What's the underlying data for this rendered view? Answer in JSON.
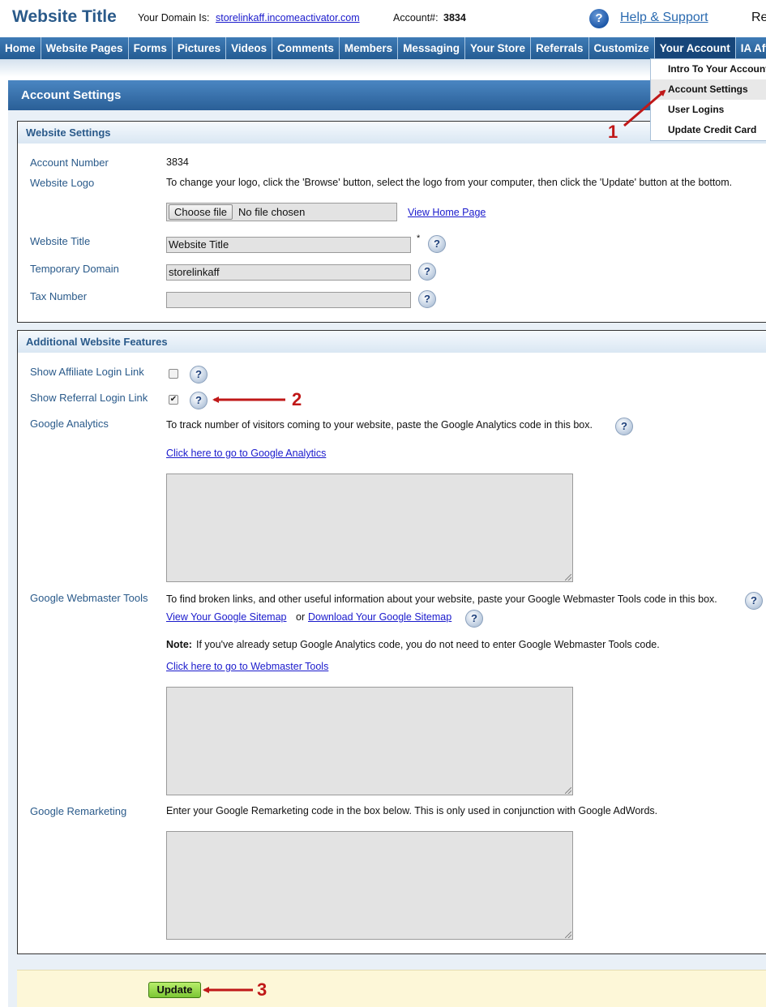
{
  "header": {
    "site_title": "Website Title",
    "domain_label": "Your Domain Is:",
    "domain_link": "storelinkaff.incomeactivator.com",
    "account_label": "Account#:",
    "account_number": "3834",
    "help_icon": "question-icon",
    "help_link": "Help & Support",
    "truncated_text": "Re"
  },
  "nav": {
    "items": [
      "Home",
      "Website Pages",
      "Forms",
      "Pictures",
      "Videos",
      "Comments",
      "Members",
      "Messaging",
      "Your Store",
      "Referrals",
      "Customize",
      "Your Account",
      "IA Affi"
    ],
    "active": "Your Account",
    "bar_color": "#2f6aa4"
  },
  "dropdown": {
    "items": [
      "Intro To Your Account",
      "Account Settings",
      "User Logins",
      "Update Credit Card"
    ],
    "selected": "Account Settings"
  },
  "panel": {
    "title": "Account Settings"
  },
  "website_settings": {
    "title": "Website Settings",
    "account_number_label": "Account Number",
    "account_number_value": "3834",
    "logo_label": "Website Logo",
    "logo_instructions": "To change your logo, click the 'Browse' button, select the logo from your computer, then click the 'Update' button at the bottom.",
    "file_button": "Choose file",
    "file_status": "No file chosen",
    "view_home_link": "View Home Page",
    "title_label": "Website Title",
    "title_value": "Website Title",
    "required_mark": "*",
    "temp_domain_label": "Temporary Domain",
    "temp_domain_value": "storelinkaff",
    "tax_label": "Tax Number",
    "tax_value": ""
  },
  "additional_features": {
    "title": "Additional Website Features",
    "affiliate_label": "Show Affiliate Login Link",
    "affiliate_checked": false,
    "referral_label": "Show Referral Login Link",
    "referral_checked": true,
    "checkmark": "✔",
    "ga_label": "Google Analytics",
    "ga_text": "To track number of visitors coming to your website, paste the Google Analytics code in this box.",
    "ga_link": "Click here to go to Google Analytics",
    "wmt_label": "Google Webmaster Tools",
    "wmt_text": "To find broken links, and other useful information about your website, paste your Google Webmaster Tools code in this box.",
    "sitemap_view_link": "View Your Google Sitemap",
    "sitemap_or": "or",
    "sitemap_download_link": "Download Your Google Sitemap",
    "note_bold": "Note:",
    "note_text": "If you've already setup Google Analytics code, you do not need to enter Google Webmaster Tools code.",
    "wmt_link": "Click here to go to Webmaster Tools",
    "remarketing_label": "Google Remarketing",
    "remarketing_text": "Enter your Google Remarketing code in the box below. This is only used in conjunction with Google AdWords."
  },
  "footer": {
    "update_button": "Update"
  },
  "annotations": {
    "one": "1",
    "two": "2",
    "three": "3",
    "arrow_color": "#c01818"
  }
}
